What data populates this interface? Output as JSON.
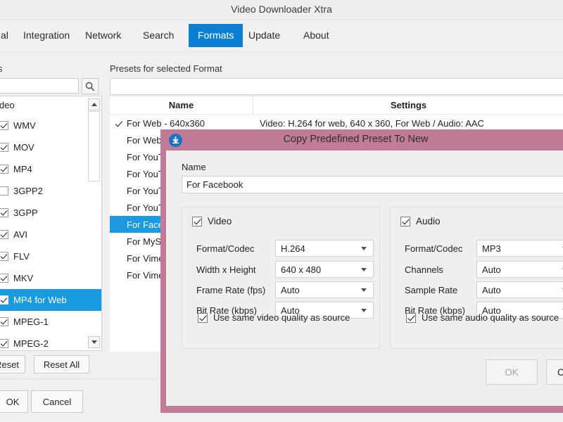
{
  "window": {
    "title": "Video Downloader Xtra"
  },
  "tabs": [
    {
      "label": "al",
      "active": false
    },
    {
      "label": "Integration",
      "active": false
    },
    {
      "label": "Network",
      "active": false
    },
    {
      "label": "Search",
      "active": false
    },
    {
      "label": "Formats",
      "active": true
    },
    {
      "label": "Update",
      "active": false
    },
    {
      "label": "About",
      "active": false
    }
  ],
  "left_panel": {
    "label": "ats",
    "search": {
      "value": "",
      "placeholder": ""
    },
    "search_icon": "search-icon",
    "group_header": "deo",
    "formats": [
      {
        "label": "WMV",
        "checked": true,
        "selected": false
      },
      {
        "label": "MOV",
        "checked": true,
        "selected": false
      },
      {
        "label": "MP4",
        "checked": true,
        "selected": false
      },
      {
        "label": "3GPP2",
        "checked": false,
        "selected": false
      },
      {
        "label": "3GPP",
        "checked": true,
        "selected": false
      },
      {
        "label": "AVI",
        "checked": true,
        "selected": false
      },
      {
        "label": "FLV",
        "checked": true,
        "selected": false
      },
      {
        "label": "MKV",
        "checked": true,
        "selected": false
      },
      {
        "label": "MP4 for Web",
        "checked": true,
        "selected": true
      },
      {
        "label": "MPEG-1",
        "checked": true,
        "selected": false
      },
      {
        "label": "MPEG-2",
        "checked": true,
        "selected": false
      },
      {
        "label": "SWF",
        "checked": true,
        "selected": false
      },
      {
        "label": "TS",
        "checked": true,
        "selected": false
      }
    ],
    "reset_label": "Reset",
    "reset_all_label": "Reset All"
  },
  "footer": {
    "ok_label": "OK",
    "cancel_label": "Cancel"
  },
  "presets": {
    "label": "Presets for selected Format",
    "filter_value": "",
    "columns": [
      "Name",
      "Settings"
    ],
    "rows": [
      {
        "checked": true,
        "name": "For Web - 640x360",
        "settings": "Video: H.264 for web, 640 x 360, For Web / Audio: AAC",
        "selected": false
      },
      {
        "checked": false,
        "name": "For Web -",
        "settings": "",
        "selected": false
      },
      {
        "checked": false,
        "name": "For YouTu",
        "settings": "",
        "selected": false
      },
      {
        "checked": false,
        "name": "For YouTu",
        "settings": "",
        "selected": false
      },
      {
        "checked": false,
        "name": "For YouTu",
        "settings": "",
        "selected": false
      },
      {
        "checked": false,
        "name": "For YouTu",
        "settings": "",
        "selected": false
      },
      {
        "checked": false,
        "name": "For Facebo",
        "settings": "",
        "selected": true
      },
      {
        "checked": false,
        "name": "For MySpa",
        "settings": "",
        "selected": false
      },
      {
        "checked": false,
        "name": "For Vimeo",
        "settings": "",
        "selected": false
      },
      {
        "checked": false,
        "name": "For Vimeo",
        "settings": "",
        "selected": false
      }
    ]
  },
  "dialog": {
    "title": "Copy Predefined Preset To New",
    "icon": "download-circle-icon",
    "name_label": "Name",
    "name_value": "For Facebook",
    "video": {
      "group_label": "Video",
      "enabled": true,
      "fields": [
        {
          "label": "Format/Codec",
          "value": "H.264"
        },
        {
          "label": "Width x Height",
          "value": "640 x 480"
        },
        {
          "label": "Frame Rate (fps)",
          "value": "Auto"
        },
        {
          "label": "Bit Rate (kbps)",
          "value": "Auto"
        }
      ],
      "use_same_label": "Use same video quality as source",
      "use_same_checked": true
    },
    "audio": {
      "group_label": "Audio",
      "enabled": true,
      "fields": [
        {
          "label": "Format/Codec",
          "value": "MP3"
        },
        {
          "label": "Channels",
          "value": "Auto"
        },
        {
          "label": "Sample Rate",
          "value": "Auto"
        },
        {
          "label": "Bit Rate (kbps)",
          "value": "Auto"
        }
      ],
      "use_same_label": "Use same audio quality as source",
      "use_same_checked": true
    },
    "ok_label": "OK",
    "cancel_label": "Cancel",
    "ok_disabled": true
  },
  "colors": {
    "accent_blue": "#0a7fd4",
    "selection_blue": "#1a9ae0",
    "dialog_border": "#c07b99",
    "dialog_bg": "#efeff0",
    "app_bg": "#f0f0f0"
  }
}
